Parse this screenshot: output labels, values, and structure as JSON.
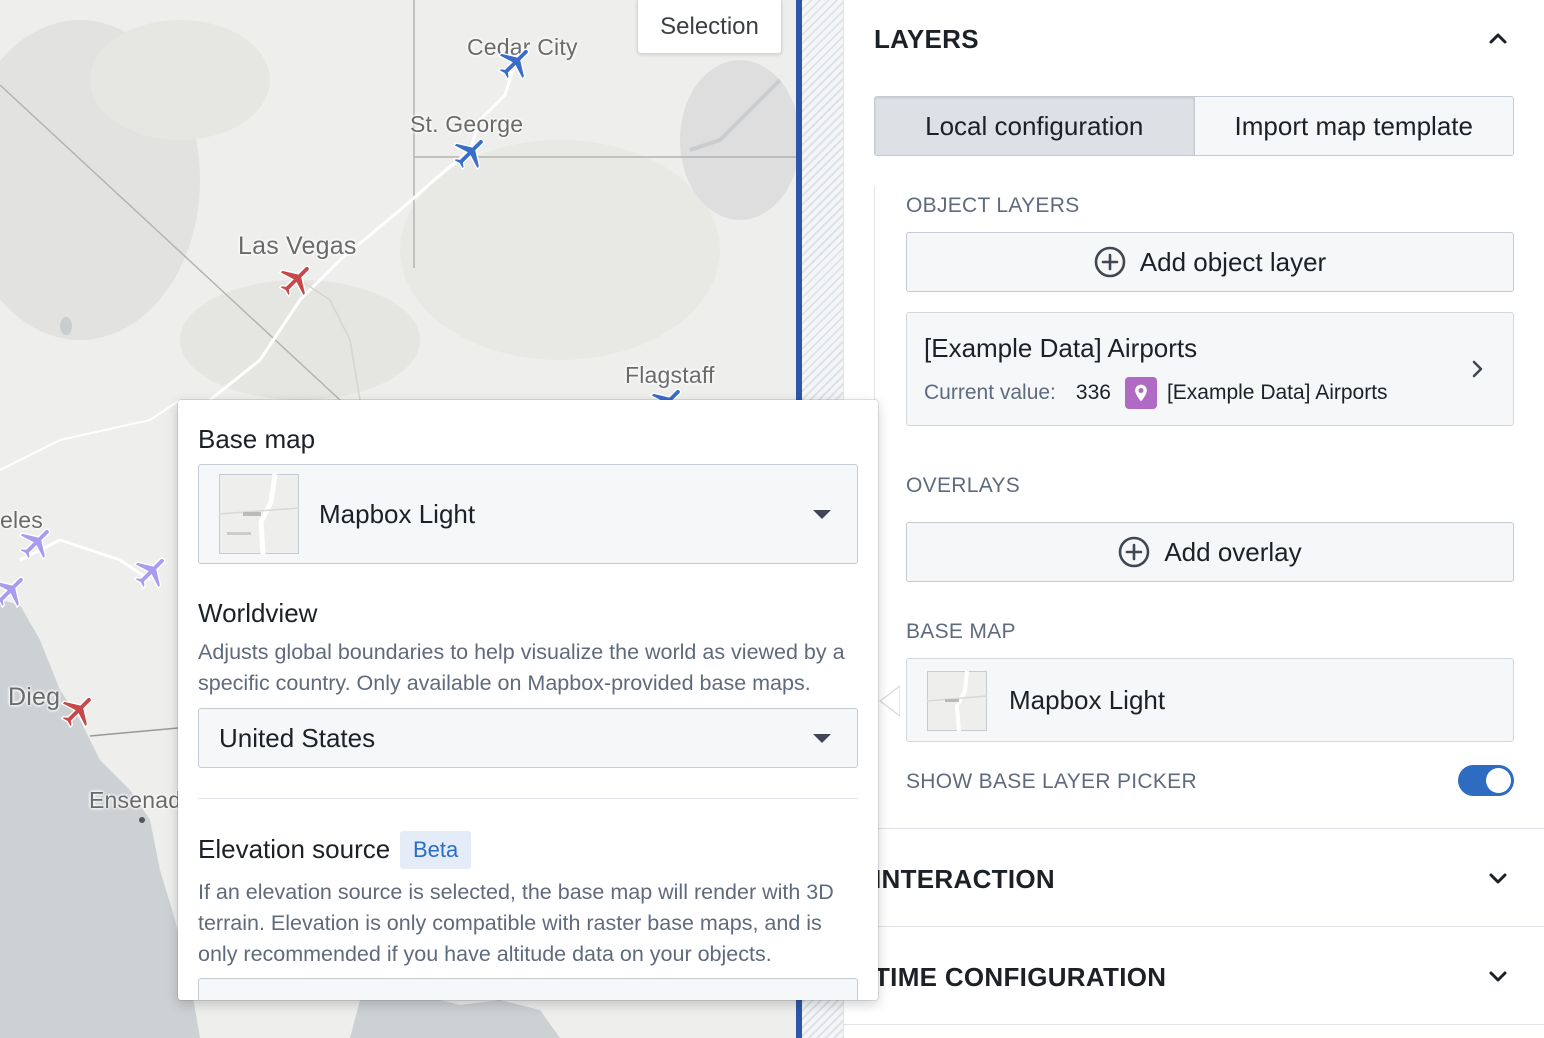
{
  "map": {
    "selection_button": "Selection",
    "cities": {
      "cedar_city": "Cedar City",
      "st_george": "St. George",
      "las_vegas": "Las Vegas",
      "flagstaff": "Flagstaff",
      "angeles_fragment": "eles",
      "diego_fragment": "Dieg",
      "ensenada_fragment": "Ensenad"
    },
    "colors": {
      "plane_blue": "#3a6dc9",
      "plane_red": "#c64848",
      "plane_purple": "#a99bef"
    }
  },
  "panel": {
    "layers_title": "LAYERS",
    "tabs": [
      {
        "label": "Local configuration",
        "active": true
      },
      {
        "label": "Import map template",
        "active": false
      }
    ],
    "object_layers_label": "OBJECT LAYERS",
    "add_object_layer": "Add object layer",
    "layer": {
      "name": "[Example Data] Airports",
      "current_value_label": "Current value:",
      "count": "336",
      "source": "[Example Data] Airports",
      "icon": "map-pin-icon",
      "icon_color": "#b06ac4"
    },
    "overlays_label": "OVERLAYS",
    "add_overlay": "Add overlay",
    "base_map_label": "BASE MAP",
    "base_map_value": "Mapbox Light",
    "show_picker_label": "SHOW BASE LAYER PICKER",
    "show_picker_enabled": true,
    "interaction_title": "INTERACTION",
    "time_config_title": "TIME CONFIGURATION",
    "accent_color": "#2d6cc0"
  },
  "popover": {
    "base_map_heading": "Base map",
    "base_map_selected": "Mapbox Light",
    "worldview_heading": "Worldview",
    "worldview_desc": "Adjusts global boundaries to help visualize the world as viewed by a specific country. Only available on Mapbox-provided base maps.",
    "worldview_selected": "United States",
    "elevation_heading": "Elevation source",
    "elevation_badge": "Beta",
    "elevation_desc": "If an elevation source is selected, the base map will render with 3D terrain. Elevation is only compatible with raster base maps, and is only recommended if you have altitude data on your objects."
  }
}
